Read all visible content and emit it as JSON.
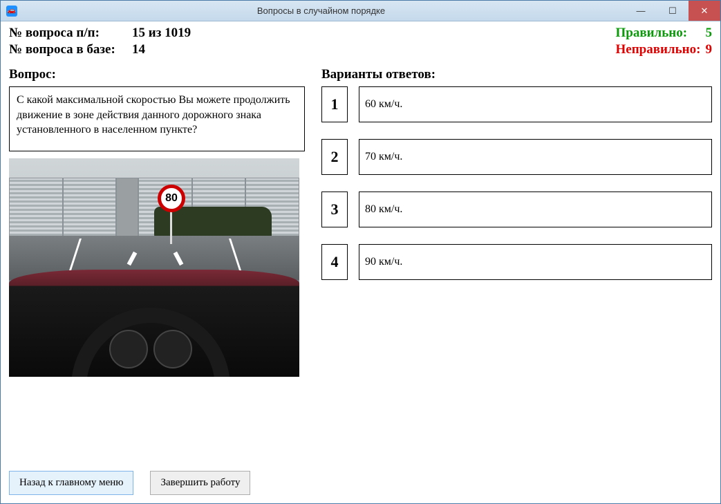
{
  "window": {
    "title": "Вопросы в случайном порядке"
  },
  "header": {
    "q_order_label": "№ вопроса п/п:",
    "q_order_value": "15 из 1019",
    "q_base_label": "№ вопроса в базе:",
    "q_base_value": "14",
    "correct_label": "Правильно:",
    "correct_value": "5",
    "wrong_label": "Неправильно:",
    "wrong_value": "9"
  },
  "question": {
    "title": "Вопрос:",
    "text": "С какой максимальной скоростью Вы можете продолжить движение в зоне действия данного дорожного знака установленного в населенном пункте?",
    "sign_value": "80"
  },
  "answers": {
    "title": "Варианты ответов:",
    "items": [
      {
        "num": "1",
        "text": "60 км/ч."
      },
      {
        "num": "2",
        "text": "70 км/ч."
      },
      {
        "num": "3",
        "text": "80 км/ч."
      },
      {
        "num": "4",
        "text": "90 км/ч."
      }
    ]
  },
  "footer": {
    "back_label": "Назад к главному меню",
    "finish_label": "Завершить работу"
  }
}
